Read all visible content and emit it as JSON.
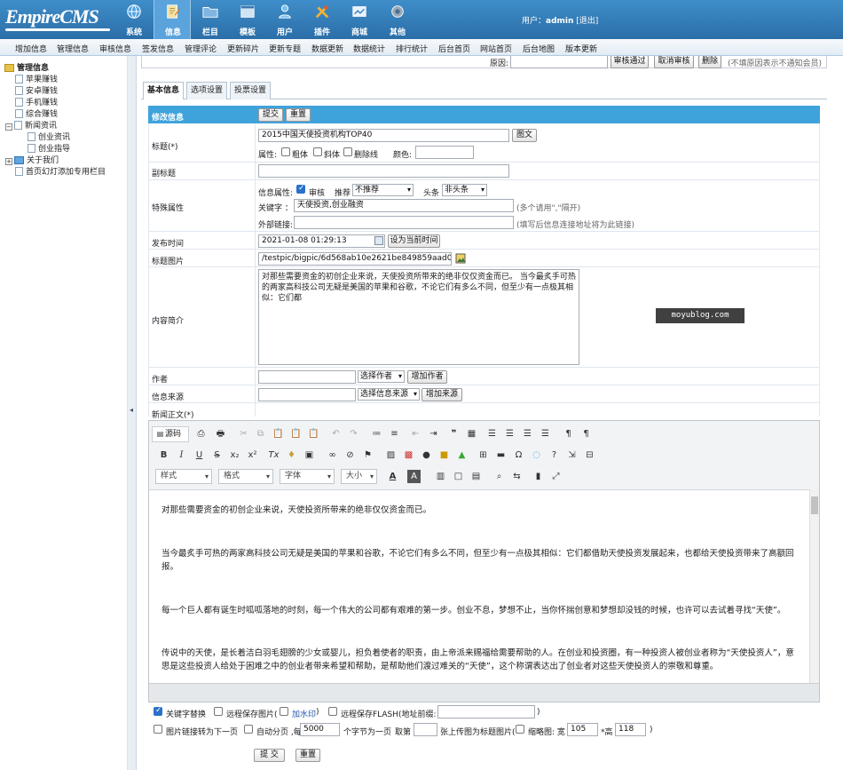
{
  "header": {
    "logo": "EmpireCMS",
    "menu": [
      {
        "label": "系统",
        "icon": "globe-icon"
      },
      {
        "label": "信息",
        "icon": "edit-icon"
      },
      {
        "label": "栏目",
        "icon": "folder-icon"
      },
      {
        "label": "模板",
        "icon": "template-icon"
      },
      {
        "label": "用户",
        "icon": "user-icon"
      },
      {
        "label": "插件",
        "icon": "plugin-icon"
      },
      {
        "label": "商城",
        "icon": "shop-icon"
      },
      {
        "label": "其他",
        "icon": "gear-icon"
      }
    ],
    "user_prefix": "用户：",
    "user_name": "admin",
    "logout": "[退出]"
  },
  "subnav": [
    "增加信息",
    "管理信息",
    "审核信息",
    "签发信息",
    "管理评论",
    "更新碎片",
    "更新专题",
    "数据更新",
    "数据统计",
    "排行统计",
    "后台首页",
    "网站首页",
    "后台地图",
    "版本更新"
  ],
  "tree": {
    "root": "管理信息",
    "items": [
      "苹果赚钱",
      "安卓赚钱",
      "手机赚钱",
      "综合赚钱"
    ],
    "news": "新闻资讯",
    "news_children": [
      "创业资讯",
      "创业指导"
    ],
    "about": "关于我们",
    "slider": "首页幻灯添加专用栏目"
  },
  "review": {
    "reason_label": "原因:",
    "approve": "审核通过",
    "cancel": "取消审核",
    "delete": "删除",
    "note": "(不填原因表示不通知会员)"
  },
  "tabs": [
    "基本信息",
    "选项设置",
    "投票设置"
  ],
  "form": {
    "section_title": "修改信息",
    "submit": "提交",
    "reset": "重置",
    "title_label": "标题(*)",
    "title_value": "2015中国天使投资机构TOP40",
    "title_btn": "图文",
    "attr_label": "属性:",
    "bold": "粗体",
    "italic": "斜体",
    "strike": "删除线",
    "color_label": "颜色:",
    "subtitle_label": "副标题",
    "special_label": "特殊属性",
    "info_attr_label": "信息属性:",
    "audit": "审核",
    "recommend_label": "推荐",
    "recommend_value": "不推荐",
    "headline_label": "头条",
    "headline_value": "非头条",
    "keywords_label": "关键字 ：",
    "keywords_value": "天使投资,创业融资",
    "keywords_note": "(多个请用\",\"隔开)",
    "extlink_label": "外部链接:",
    "extlink_note": "(填写后信息连接地址将为此链接)",
    "time_label": "发布时间",
    "time_value": "2021-01-08 01:29:13",
    "time_btn": "设为当前时间",
    "pic_label": "标题图片",
    "pic_value": "/testpic/bigpic/6d568ab10e2621be849859aad0d7eebd.j",
    "summary_label": "内容简介",
    "summary_value": "对那些需要资金的初创企业来说，天使投资所带来的绝非仅仅资金而已。 当今最炙手可热的两家高科技公司无疑是美国的苹果和谷歌，不论它们有多么不同，但至少有一点极其相似：它们都",
    "watermark": "moyublog.com",
    "author_label": "作者",
    "author_select": "选择作者",
    "author_add": "增加作者",
    "source_label": "信息来源",
    "source_select": "选择信息来源",
    "source_add": "增加来源",
    "body_label": "新闻正文(*)"
  },
  "editor": {
    "source": "源码",
    "style": "样式",
    "format": "格式",
    "font": "字体",
    "size": "大小",
    "paragraphs": [
      "对那些需要资金的初创企业来说，天使投资所带来的绝非仅仅资金而已。",
      "当今最炙手可热的两家高科技公司无疑是美国的苹果和谷歌，不论它们有多么不同，但至少有一点极其相似：它们都借助天使投资发展起来，也都给天使投资带来了高额回报。",
      "每一个巨人都有诞生时呱呱落地的时刻，每一个伟大的公司都有艰难的第一步。创业不息，梦想不止，当你怀揣创意和梦想却没钱的时候，也许可以去试着寻找“天使”。",
      "传说中的天使，是长着洁白羽毛翅膀的少女或婴儿，担负着使者的职责，由上帝派来赐福给需要帮助的人。在创业和投资圈，有一种投资人被创业者称为“天使投资人”，意思是这些投资人给处于困难之中的创业者带来希望和帮助，是帮助他们渡过难关的“天使”，这个称谓表达出了创业者对这些天使投资人的崇敬和尊重。"
    ]
  },
  "options": {
    "kw_replace": "关键字替换",
    "remote_pic": "远程保存图片(",
    "watermark_link": "加水印",
    "remote_pic_end": ")",
    "remote_flash": "远程保存FLASH(地址前缀:",
    "remote_flash_end": ")",
    "pic_link_next": "图片链接转为下一页",
    "auto_page": "自动分页 ,每",
    "page_chars": "5000",
    "page_chars_suffix": "个字节为一页",
    "take_label": "取第",
    "take_suffix": "张上传图为标题图片(",
    "thumb_label": "缩略图: 宽",
    "thumb_w": "105",
    "thumb_h_label": "*高",
    "thumb_h": "118",
    "thumb_end": ")"
  },
  "footer": {
    "submit": "提 交",
    "reset": "重置"
  }
}
